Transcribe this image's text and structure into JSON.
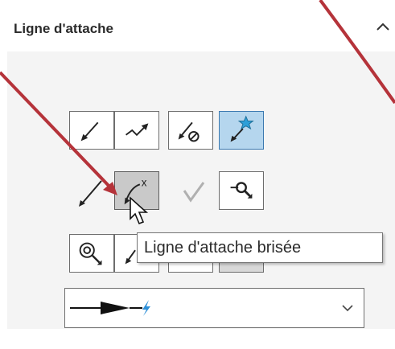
{
  "section": {
    "title": "Ligne d'attache",
    "collapse_icon": "chevron-up-icon"
  },
  "tool_rows": [
    [
      {
        "name": "leader-straight-button",
        "icon": "straight-arrow-icon",
        "state": "normal"
      },
      {
        "name": "leader-spline-button",
        "icon": "spline-arrow-icon",
        "state": "normal"
      },
      {
        "name": "leader-none-button",
        "icon": "no-leader-icon",
        "state": "normal"
      },
      {
        "name": "leader-auto-button",
        "icon": "star-arrow-icon",
        "state": "selected"
      }
    ],
    [
      {
        "name": "leader-bent-button",
        "icon": "double-arrow-icon",
        "state": "normal"
      },
      {
        "name": "leader-broken-button",
        "icon": "broken-leader-icon",
        "state": "pressed"
      },
      {
        "name": "leader-check-button",
        "icon": "check-icon",
        "state": "disabled"
      },
      {
        "name": "leader-attach-button",
        "icon": "attach-magnifier-icon",
        "state": "normal"
      }
    ]
  ],
  "tooltip": {
    "text": "Ligne d'attache brisée"
  },
  "dropdown": {
    "selected_icon": "arrow-style-icon",
    "chevron_icon": "chevron-down-icon"
  },
  "colors": {
    "accent_selected": "#b5d6ee",
    "annotation_arrow": "#b5333a",
    "star": "#2d9fd8"
  }
}
